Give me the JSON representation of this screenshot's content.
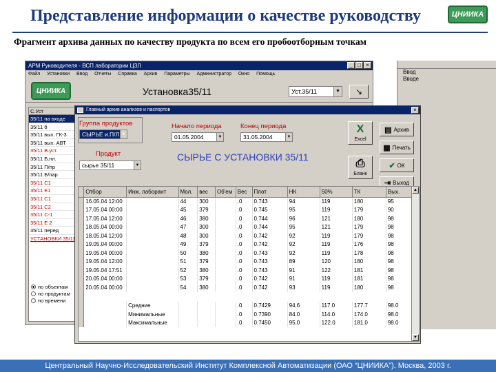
{
  "slide": {
    "title": "Представление информации о качестве руководству",
    "logo_text": "ЦНИИКА",
    "subtitle": "Фрагмент архива данных по качеству продукта по всем его пробоотборным точкам",
    "footer": "Центральный Научно-Исследовательский Институт Комплексной Автоматизации (ОАО “ЦНИИКА”). Москва, 2003 г."
  },
  "app": {
    "window_title": "АРМ Руководителя - ВСП лаборатории ЦЗЛ",
    "menu": "Файл Установки Ввод Отчеты Справка Архив Параметры Администратор Окно Помощь",
    "logo_text": "ЦНИИКА",
    "unit_title": "Установка35/11",
    "unit_combo": "Уст.35/11",
    "go_glyph": "↘",
    "left_panel_header": "С.Уст",
    "left_items": [
      "35/11 на входе",
      "35/11 б",
      "35/11 вых. ГК-3",
      "35/11 вых. АВТ",
      "35/11 В.уст.",
      "35/11 Б.пл.",
      "35/11 П/пр",
      "35/11 Б/пар",
      "35/11 С1",
      "35/11 Е1",
      "35/11 С1",
      "35/11 С2",
      "35/11 С-1",
      "35/11 Е 2",
      "35/11 перед",
      "УСТАНОВКИ 35/11"
    ],
    "radios": [
      "по объектам",
      "по продуктам",
      "по времени"
    ],
    "side_window": {
      "line1": "Ввод",
      "line2": "Вводе"
    }
  },
  "dialog": {
    "title": "Главный архив анализов и паспортов",
    "group_label": "Группа продуктов",
    "group_value": "СЫРЬЕ и.П/Л",
    "product_label": "Продукт",
    "product_value": "сырье 35/11",
    "period_start_label": "Начало периода",
    "period_start_value": "01.05.2004",
    "period_end_label": "Конец периода",
    "period_end_value": "31.05.2004",
    "big_title": "СЫРЬЕ С УСТАНОВКИ 35/11",
    "buttons": {
      "excel": "Excel",
      "print_form": "Печать",
      "archive": "Архив",
      "print": "Печать",
      "ok": "ОК",
      "forms": "Бланк",
      "exit": "Выход"
    },
    "grid": {
      "columns": [
        "Отбор",
        "Инж. лаборант",
        "Мол.",
        "вес",
        "Об'ем",
        "Вес",
        "Плот",
        "НК",
        "50%",
        "ТК",
        "Вых."
      ],
      "rows": [
        [
          "16.05.04 12:00",
          "",
          "44",
          "300",
          "",
          ".0",
          "0.743",
          "94",
          "119",
          "180",
          "95"
        ],
        [
          "17.05.04 00:00",
          "",
          "45",
          "379",
          "",
          ".0",
          "0.745",
          "95",
          "119",
          "179",
          "90"
        ],
        [
          "17.05.04 12:00",
          "",
          "46",
          "380",
          "",
          ".0",
          "0.744",
          "96",
          "121",
          "180",
          "98"
        ],
        [
          "18.05.04 00:00",
          "",
          "47",
          "300",
          "",
          ".0",
          "0.744",
          "95",
          "121",
          "179",
          "98"
        ],
        [
          "18.05.04 12:00",
          "",
          "48",
          "300",
          "",
          ".0",
          "0.742",
          "92",
          "119",
          "179",
          "98"
        ],
        [
          "19.05.04 00:00",
          "",
          "49",
          "379",
          "",
          ".0",
          "0.742",
          "92",
          "119",
          "176",
          "98"
        ],
        [
          "19.05.04 00:00",
          "",
          "50",
          "380",
          "",
          ".0",
          "0.743",
          "92",
          "119",
          "178",
          "98"
        ],
        [
          "19.05.04 12:00",
          "",
          "51",
          "379",
          "",
          ".0",
          "0.743",
          "89",
          "120",
          "180",
          "98"
        ],
        [
          "19.05.04 17:51",
          "",
          "52",
          "380",
          "",
          ".0",
          "0.743",
          "91",
          "122",
          "181",
          "98"
        ],
        [
          "20.05.04 00:00",
          "",
          "53",
          "379",
          "",
          ".0",
          "0.742",
          "91",
          "119",
          "181",
          "98"
        ],
        [
          "20.05.04 00:00",
          "",
          "54",
          "380",
          "",
          ".0",
          "0.742",
          "93",
          "119",
          "180",
          "98"
        ]
      ],
      "summary": [
        [
          "",
          "Средние",
          "",
          "",
          "",
          ".0",
          "0.7429",
          "94.6",
          "117.0",
          "177.7",
          "98.0"
        ],
        [
          "",
          "Минимальные",
          "",
          "",
          "",
          ".0",
          "0.7390",
          "84.0",
          "114.0",
          "174.0",
          "98.0"
        ],
        [
          "",
          "Максимальные",
          "",
          "",
          "",
          ".0",
          "0.7450",
          "95.0",
          "122.0",
          "181.0",
          "98.0"
        ]
      ]
    }
  }
}
